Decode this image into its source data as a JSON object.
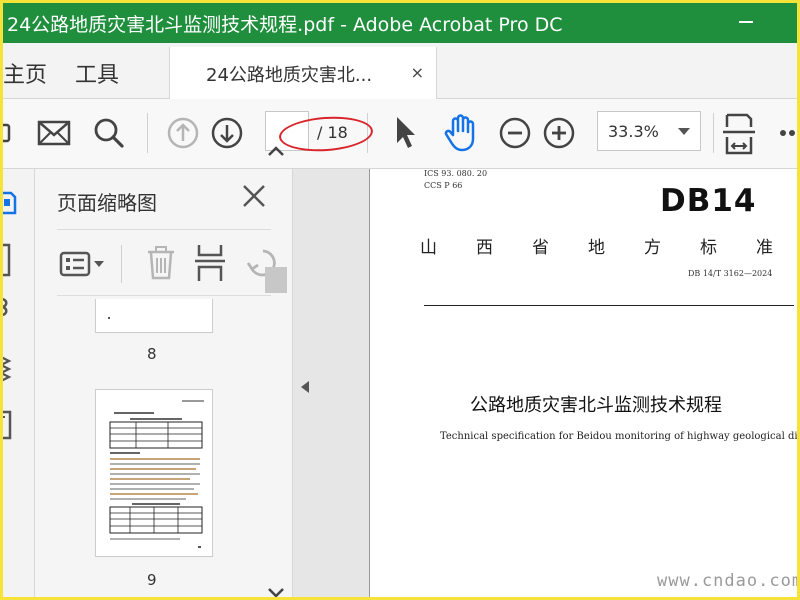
{
  "window": {
    "title": "24公路地质灾害北斗监测技术规程.pdf - Adobe Acrobat Pro DC"
  },
  "tabs": {
    "home": "主页",
    "tools": "工具",
    "document": "24公路地质灾害北...",
    "close": "×"
  },
  "toolbar": {
    "page_current": "",
    "page_total": "/ 18",
    "zoom": "33.3%"
  },
  "thumbnails": {
    "title": "页面缩略图",
    "pages": [
      {
        "label": "8"
      },
      {
        "label": "9"
      }
    ]
  },
  "document": {
    "ics": "ICS  93. 080. 20",
    "ccs": "CCS  P  66",
    "logo": "DB14",
    "province": "山西省地方标准",
    "standard_no": "DB 14/T 3162—2024",
    "title_zh": "公路地质灾害北斗监测技术规程",
    "title_en": "Technical specification for Beidou monitoring of highway geological disasters"
  },
  "watermark": "www.cndao.com",
  "colors": {
    "titlebar": "#1f8e3d",
    "accent_blue": "#1473e6",
    "highlight_oval": "#d8242a",
    "frame": "#f5e33a"
  }
}
